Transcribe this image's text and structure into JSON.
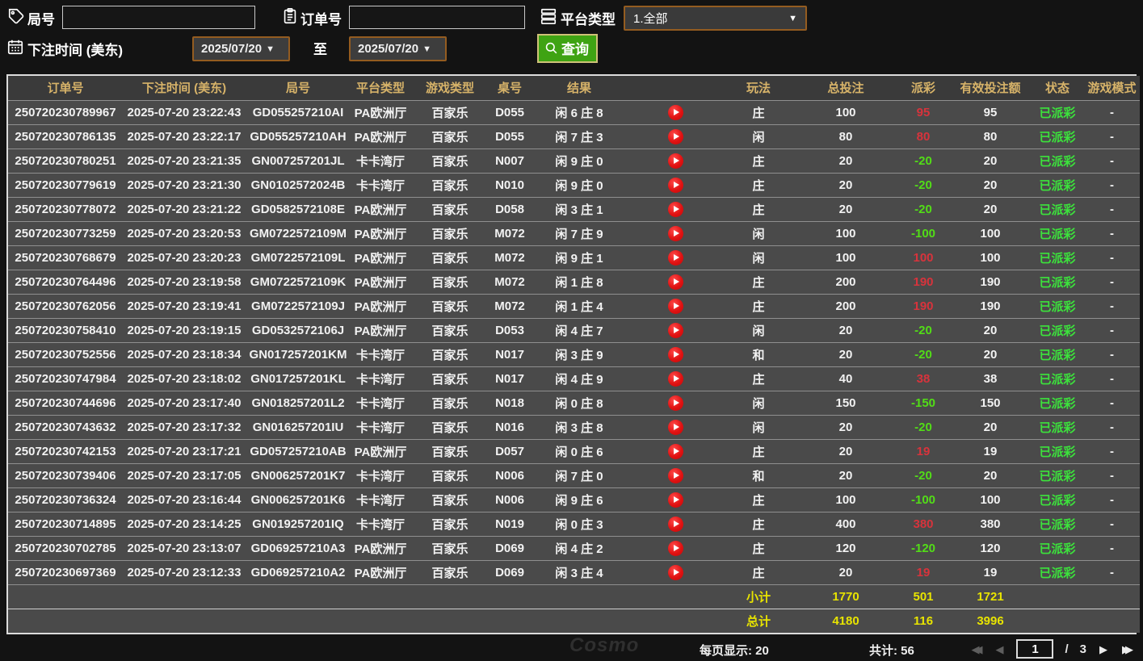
{
  "filters": {
    "game_no_label": "局号",
    "game_no_value": "",
    "order_no_label": "订单号",
    "order_no_value": "",
    "platform_type_label": "平台类型",
    "platform_type_value": "1.全部",
    "bet_time_label": "下注时间 (美东)",
    "date_from": "2025/07/20",
    "to_label": "至",
    "date_to": "2025/07/20",
    "search_button_label": "查询"
  },
  "table": {
    "columns": [
      "订单号",
      "下注时间 (美东)",
      "局号",
      "平台类型",
      "游戏类型",
      "桌号",
      "结果",
      "",
      "玩法",
      "总投注",
      "派彩",
      "有效投注额",
      "状态",
      "游戏模式"
    ],
    "rows": [
      {
        "order_no": "250720230789967",
        "bet_time": "2025-07-20 23:22:43",
        "game_no": "GD055257210AI",
        "platform": "PA欧洲厅",
        "game_type": "百家乐",
        "table_no": "D055",
        "result": "闲 6 庄 8",
        "bet_type": "庄",
        "total_bet": "100",
        "payout": "95",
        "valid_bet": "95",
        "status": "已派彩",
        "mode": "-"
      },
      {
        "order_no": "250720230786135",
        "bet_time": "2025-07-20 23:22:17",
        "game_no": "GD055257210AH",
        "platform": "PA欧洲厅",
        "game_type": "百家乐",
        "table_no": "D055",
        "result": "闲 7 庄 3",
        "bet_type": "闲",
        "total_bet": "80",
        "payout": "80",
        "valid_bet": "80",
        "status": "已派彩",
        "mode": "-"
      },
      {
        "order_no": "250720230780251",
        "bet_time": "2025-07-20 23:21:35",
        "game_no": "GN007257201JL",
        "platform": "卡卡湾厅",
        "game_type": "百家乐",
        "table_no": "N007",
        "result": "闲 9 庄 0",
        "bet_type": "庄",
        "total_bet": "20",
        "payout": "-20",
        "valid_bet": "20",
        "status": "已派彩",
        "mode": "-"
      },
      {
        "order_no": "250720230779619",
        "bet_time": "2025-07-20 23:21:30",
        "game_no": "GN0102572024B",
        "platform": "卡卡湾厅",
        "game_type": "百家乐",
        "table_no": "N010",
        "result": "闲 9 庄 0",
        "bet_type": "庄",
        "total_bet": "20",
        "payout": "-20",
        "valid_bet": "20",
        "status": "已派彩",
        "mode": "-"
      },
      {
        "order_no": "250720230778072",
        "bet_time": "2025-07-20 23:21:22",
        "game_no": "GD0582572108E",
        "platform": "PA欧洲厅",
        "game_type": "百家乐",
        "table_no": "D058",
        "result": "闲 3 庄 1",
        "bet_type": "庄",
        "total_bet": "20",
        "payout": "-20",
        "valid_bet": "20",
        "status": "已派彩",
        "mode": "-"
      },
      {
        "order_no": "250720230773259",
        "bet_time": "2025-07-20 23:20:53",
        "game_no": "GM0722572109M",
        "platform": "PA欧洲厅",
        "game_type": "百家乐",
        "table_no": "M072",
        "result": "闲 7 庄 9",
        "bet_type": "闲",
        "total_bet": "100",
        "payout": "-100",
        "valid_bet": "100",
        "status": "已派彩",
        "mode": "-"
      },
      {
        "order_no": "250720230768679",
        "bet_time": "2025-07-20 23:20:23",
        "game_no": "GM0722572109L",
        "platform": "PA欧洲厅",
        "game_type": "百家乐",
        "table_no": "M072",
        "result": "闲 9 庄 1",
        "bet_type": "闲",
        "total_bet": "100",
        "payout": "100",
        "valid_bet": "100",
        "status": "已派彩",
        "mode": "-"
      },
      {
        "order_no": "250720230764496",
        "bet_time": "2025-07-20 23:19:58",
        "game_no": "GM0722572109K",
        "platform": "PA欧洲厅",
        "game_type": "百家乐",
        "table_no": "M072",
        "result": "闲 1 庄 8",
        "bet_type": "庄",
        "total_bet": "200",
        "payout": "190",
        "valid_bet": "190",
        "status": "已派彩",
        "mode": "-"
      },
      {
        "order_no": "250720230762056",
        "bet_time": "2025-07-20 23:19:41",
        "game_no": "GM0722572109J",
        "platform": "PA欧洲厅",
        "game_type": "百家乐",
        "table_no": "M072",
        "result": "闲 1 庄 4",
        "bet_type": "庄",
        "total_bet": "200",
        "payout": "190",
        "valid_bet": "190",
        "status": "已派彩",
        "mode": "-"
      },
      {
        "order_no": "250720230758410",
        "bet_time": "2025-07-20 23:19:15",
        "game_no": "GD0532572106J",
        "platform": "PA欧洲厅",
        "game_type": "百家乐",
        "table_no": "D053",
        "result": "闲 4 庄 7",
        "bet_type": "闲",
        "total_bet": "20",
        "payout": "-20",
        "valid_bet": "20",
        "status": "已派彩",
        "mode": "-"
      },
      {
        "order_no": "250720230752556",
        "bet_time": "2025-07-20 23:18:34",
        "game_no": "GN017257201KM",
        "platform": "卡卡湾厅",
        "game_type": "百家乐",
        "table_no": "N017",
        "result": "闲 3 庄 9",
        "bet_type": "和",
        "total_bet": "20",
        "payout": "-20",
        "valid_bet": "20",
        "status": "已派彩",
        "mode": "-"
      },
      {
        "order_no": "250720230747984",
        "bet_time": "2025-07-20 23:18:02",
        "game_no": "GN017257201KL",
        "platform": "卡卡湾厅",
        "game_type": "百家乐",
        "table_no": "N017",
        "result": "闲 4 庄 9",
        "bet_type": "庄",
        "total_bet": "40",
        "payout": "38",
        "valid_bet": "38",
        "status": "已派彩",
        "mode": "-"
      },
      {
        "order_no": "250720230744696",
        "bet_time": "2025-07-20 23:17:40",
        "game_no": "GN018257201L2",
        "platform": "卡卡湾厅",
        "game_type": "百家乐",
        "table_no": "N018",
        "result": "闲 0 庄 8",
        "bet_type": "闲",
        "total_bet": "150",
        "payout": "-150",
        "valid_bet": "150",
        "status": "已派彩",
        "mode": "-"
      },
      {
        "order_no": "250720230743632",
        "bet_time": "2025-07-20 23:17:32",
        "game_no": "GN016257201IU",
        "platform": "卡卡湾厅",
        "game_type": "百家乐",
        "table_no": "N016",
        "result": "闲 3 庄 8",
        "bet_type": "闲",
        "total_bet": "20",
        "payout": "-20",
        "valid_bet": "20",
        "status": "已派彩",
        "mode": "-"
      },
      {
        "order_no": "250720230742153",
        "bet_time": "2025-07-20 23:17:21",
        "game_no": "GD057257210AB",
        "platform": "PA欧洲厅",
        "game_type": "百家乐",
        "table_no": "D057",
        "result": "闲 0 庄 6",
        "bet_type": "庄",
        "total_bet": "20",
        "payout": "19",
        "valid_bet": "19",
        "status": "已派彩",
        "mode": "-"
      },
      {
        "order_no": "250720230739406",
        "bet_time": "2025-07-20 23:17:05",
        "game_no": "GN006257201K7",
        "platform": "卡卡湾厅",
        "game_type": "百家乐",
        "table_no": "N006",
        "result": "闲 7 庄 0",
        "bet_type": "和",
        "total_bet": "20",
        "payout": "-20",
        "valid_bet": "20",
        "status": "已派彩",
        "mode": "-"
      },
      {
        "order_no": "250720230736324",
        "bet_time": "2025-07-20 23:16:44",
        "game_no": "GN006257201K6",
        "platform": "卡卡湾厅",
        "game_type": "百家乐",
        "table_no": "N006",
        "result": "闲 9 庄 6",
        "bet_type": "庄",
        "total_bet": "100",
        "payout": "-100",
        "valid_bet": "100",
        "status": "已派彩",
        "mode": "-"
      },
      {
        "order_no": "250720230714895",
        "bet_time": "2025-07-20 23:14:25",
        "game_no": "GN019257201IQ",
        "platform": "卡卡湾厅",
        "game_type": "百家乐",
        "table_no": "N019",
        "result": "闲 0 庄 3",
        "bet_type": "庄",
        "total_bet": "400",
        "payout": "380",
        "valid_bet": "380",
        "status": "已派彩",
        "mode": "-"
      },
      {
        "order_no": "250720230702785",
        "bet_time": "2025-07-20 23:13:07",
        "game_no": "GD069257210A3",
        "platform": "PA欧洲厅",
        "game_type": "百家乐",
        "table_no": "D069",
        "result": "闲 4 庄 2",
        "bet_type": "庄",
        "total_bet": "120",
        "payout": "-120",
        "valid_bet": "120",
        "status": "已派彩",
        "mode": "-"
      },
      {
        "order_no": "250720230697369",
        "bet_time": "2025-07-20 23:12:33",
        "game_no": "GD069257210A2",
        "platform": "PA欧洲厅",
        "game_type": "百家乐",
        "table_no": "D069",
        "result": "闲 3 庄 4",
        "bet_type": "庄",
        "total_bet": "20",
        "payout": "19",
        "valid_bet": "19",
        "status": "已派彩",
        "mode": "-"
      }
    ],
    "subtotal": {
      "label": "小计",
      "total_bet": "1770",
      "payout": "501",
      "valid_bet": "1721"
    },
    "grand_total": {
      "label": "总计",
      "total_bet": "4180",
      "payout": "116",
      "valid_bet": "3996"
    }
  },
  "footer": {
    "page_size_text": "每页显示: 20",
    "total_count_text": "共计: 56",
    "current_page": "1",
    "page_separator": "/",
    "total_pages": "3"
  },
  "watermark_text": "Cosmo",
  "colors": {
    "win_red": "#d8333c",
    "loss_green": "#52dd17",
    "status_green": "#3ce23c",
    "total_yellow": "#e8e400",
    "header_gold": "#d7b369",
    "search_button_green": "#3fa313",
    "control_border_orange": "#945c20"
  }
}
